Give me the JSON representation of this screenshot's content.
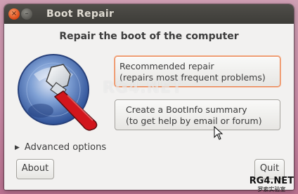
{
  "window": {
    "title": "Boot Repair",
    "controls": {
      "close_glyph": "×",
      "minimize_glyph": "–"
    }
  },
  "main": {
    "heading": "Repair the boot of the computer",
    "recommended_button": {
      "line1": "Recommended repair",
      "line2": "(repairs most frequent problems)"
    },
    "bootinfo_button": {
      "line1": "Create a BootInfo summary",
      "line2": "(to get help by email or forum)"
    },
    "advanced_options": {
      "label": "Advanced options",
      "expander_glyph": "▶"
    }
  },
  "footer": {
    "about_label": "About",
    "quit_label": "Quit"
  },
  "watermark": {
    "center_text": "RG4.NET",
    "corner_big": "RG4.NET",
    "corner_small": "罗索实验室"
  },
  "icons": {
    "logo": "wrench-on-disc-icon",
    "cursor": "mouse-pointer-icon"
  },
  "colors": {
    "titlebar": "#3d3c38",
    "close_button": "#dd4814",
    "window_bg": "#f2f1f0",
    "focus_ring": "#e88a5c",
    "desktop": "#c98aa6"
  }
}
